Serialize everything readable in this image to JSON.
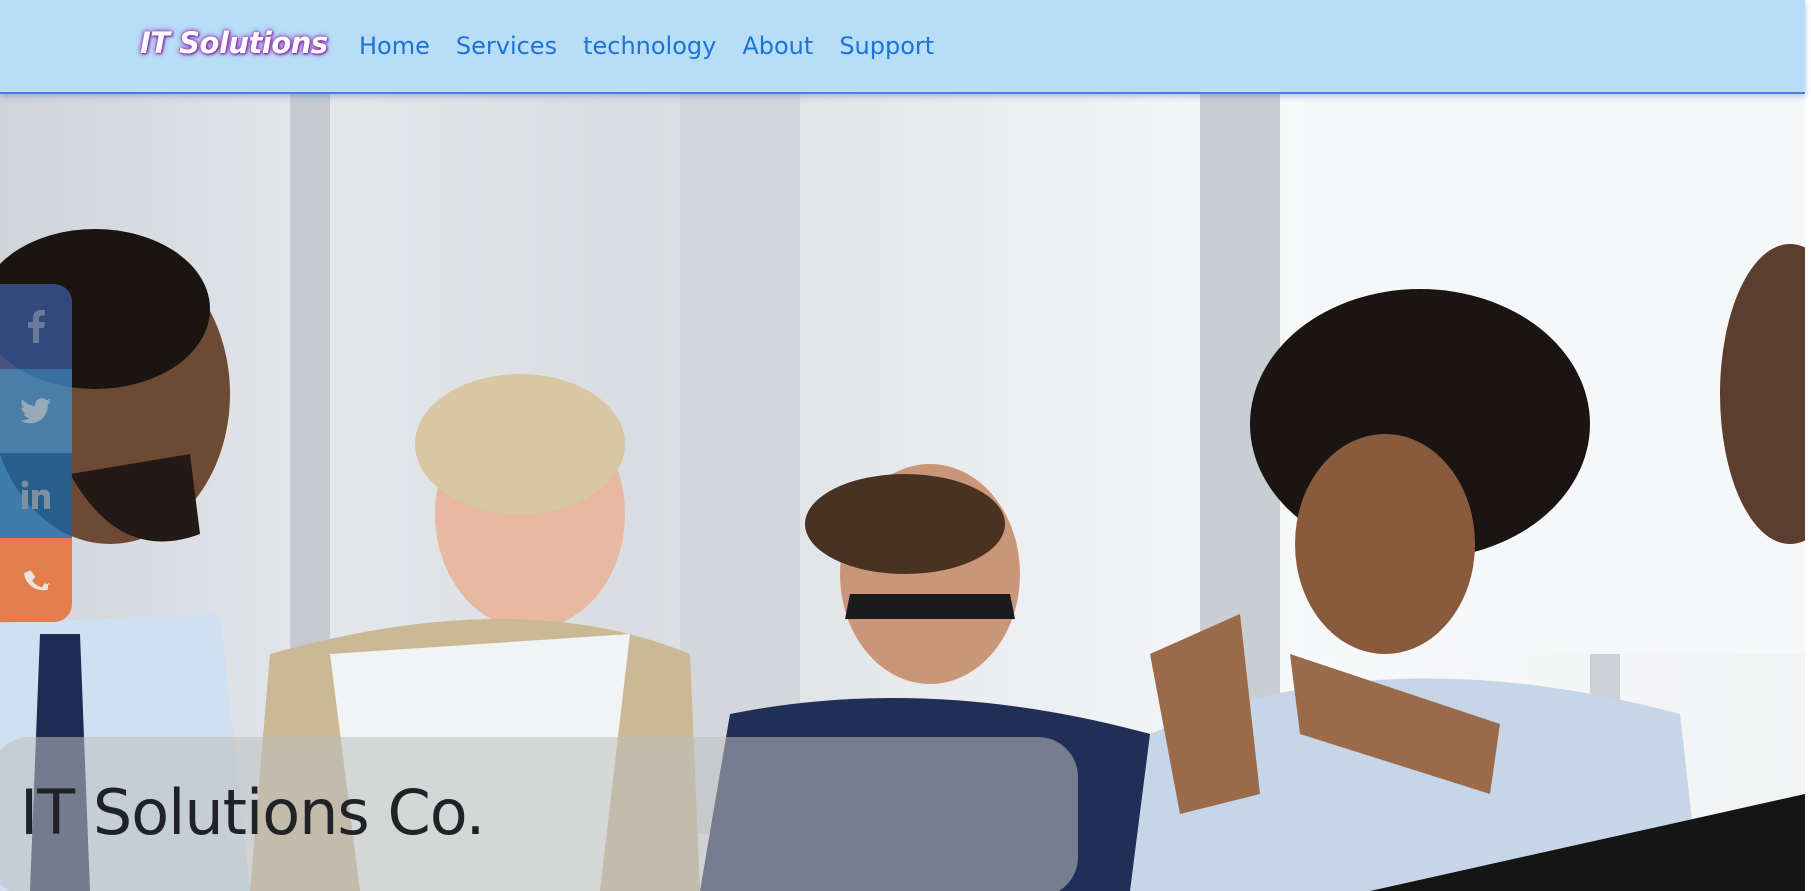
{
  "navbar": {
    "brand": "IT Solutions",
    "links": [
      {
        "label": "Home"
      },
      {
        "label": "Services"
      },
      {
        "label": "technology"
      },
      {
        "label": "About"
      },
      {
        "label": "Support"
      }
    ]
  },
  "social": [
    {
      "icon": "facebook-icon"
    },
    {
      "icon": "twitter-icon"
    },
    {
      "icon": "linkedin-icon"
    },
    {
      "icon": "phone-icon"
    }
  ],
  "hero": {
    "caption": "IT Solutions Co."
  },
  "colors": {
    "navbar_bg": "#b7ddf7",
    "nav_link": "#1e73d8",
    "brand_glow": "#8b2ca8"
  }
}
